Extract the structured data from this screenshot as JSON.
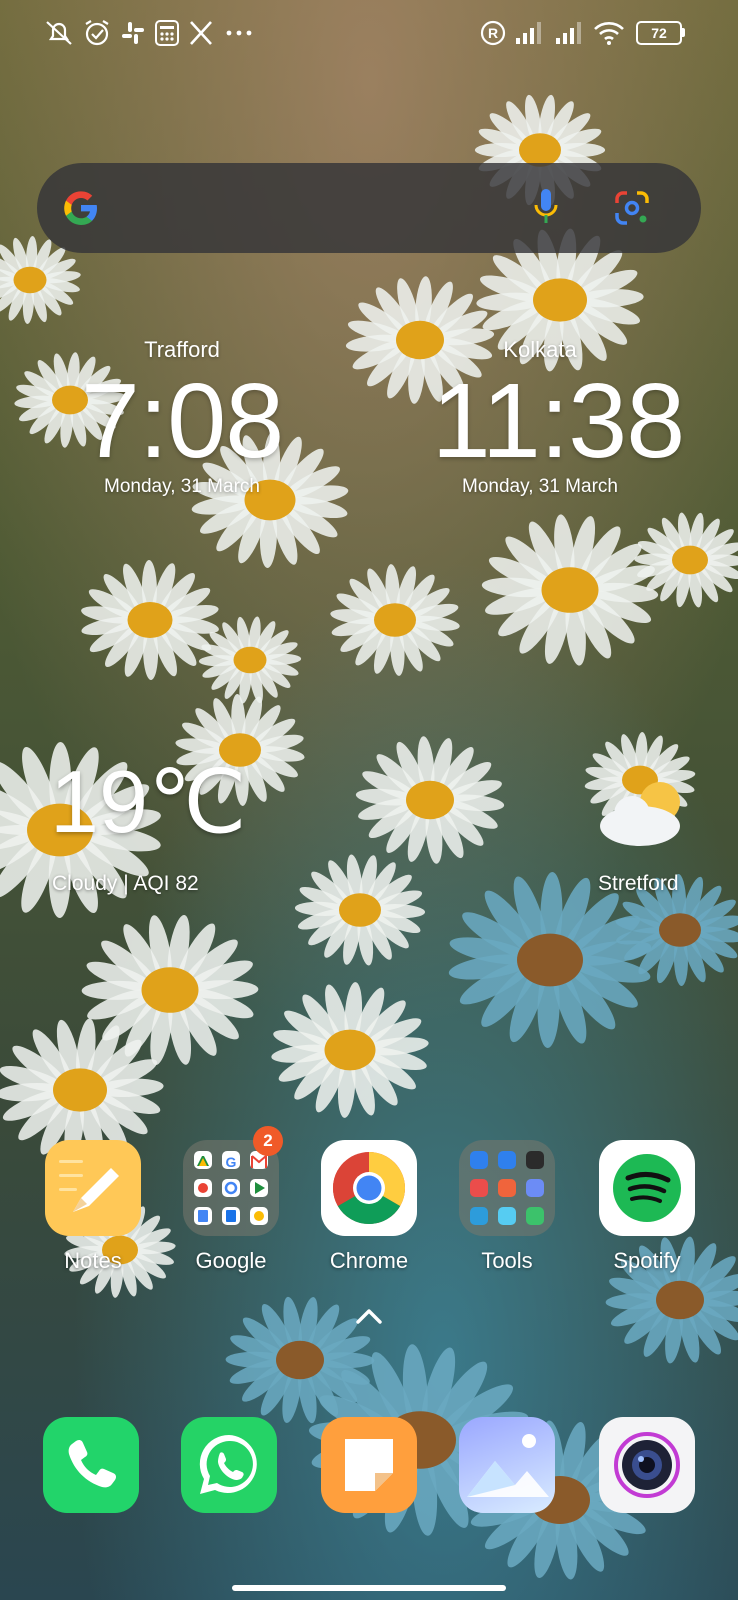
{
  "status_bar": {
    "left_icons": [
      "bell-off-icon",
      "alarm-clock-icon",
      "slack-icon",
      "calculator-icon",
      "x-logo-icon",
      "more-dots-icon"
    ],
    "right_icons": [
      "registered-icon",
      "signal-bars-1-icon",
      "signal-bars-2-icon",
      "wifi-icon"
    ],
    "battery": "72"
  },
  "search_bar": {
    "left_icon": "google-g-icon",
    "mic_icon": "microphone-icon",
    "lens_icon": "google-lens-icon"
  },
  "clocks": [
    {
      "city": "Trafford",
      "time": "7:08",
      "date": "Monday, 31 March"
    },
    {
      "city": "Kolkata",
      "time": "11:38",
      "date": "Monday, 31 March"
    }
  ],
  "weather": {
    "temperature": "19℃",
    "summary": "Cloudy | AQI 82",
    "location": "Stretford",
    "icon": "partly-cloudy-icon"
  },
  "home_apps": [
    {
      "label": "Notes",
      "icon": "notes-icon"
    },
    {
      "label": "Google",
      "icon": "google-folder-icon",
      "badge": "2"
    },
    {
      "label": "Chrome",
      "icon": "chrome-icon"
    },
    {
      "label": "Tools",
      "icon": "tools-folder-icon"
    },
    {
      "label": "Spotify",
      "icon": "spotify-icon"
    }
  ],
  "drawer_indicator": "chevron-up-icon",
  "dock": [
    {
      "icon": "phone-icon"
    },
    {
      "icon": "whatsapp-icon"
    },
    {
      "icon": "notes-app-icon"
    },
    {
      "icon": "gallery-icon"
    },
    {
      "icon": "camera-icon"
    }
  ],
  "colors": {
    "badge": "#f05a28",
    "search_bg": "#343438",
    "phone": "#22d46a",
    "whatsapp": "#25d366",
    "spotify": "#1db954"
  }
}
